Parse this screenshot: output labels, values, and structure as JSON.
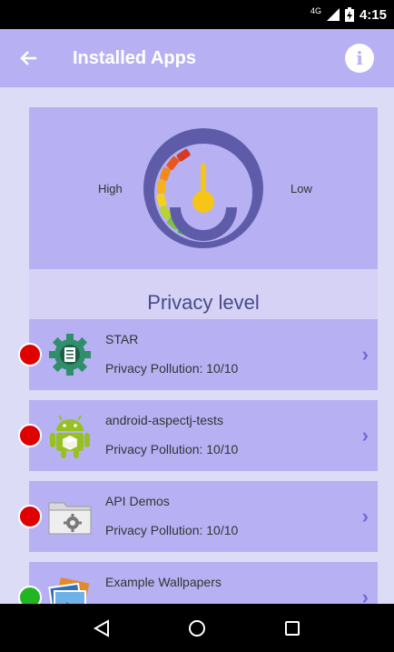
{
  "status_bar": {
    "network": "4G",
    "time": "4:15"
  },
  "app_bar": {
    "title": "Installed Apps",
    "back_icon": "arrow-left-icon",
    "info_icon": "info-icon",
    "info_glyph": "i"
  },
  "privacy": {
    "high_label": "High",
    "low_label": "Low",
    "title": "Privacy level",
    "gauge_level": 0.1
  },
  "apps": [
    {
      "name": "STAR",
      "pollution": "Privacy Pollution: 10/10",
      "status_color": "#e00000",
      "icon": "gear-document-icon"
    },
    {
      "name": "android-aspectj-tests",
      "pollution": "Privacy Pollution: 10/10",
      "status_color": "#e00000",
      "icon": "android-robot-icon"
    },
    {
      "name": "API Demos",
      "pollution": "Privacy Pollution: 10/10",
      "status_color": "#e00000",
      "icon": "folder-gear-icon"
    },
    {
      "name": "Example Wallpapers",
      "pollution": "",
      "status_color": "#22b522",
      "icon": "pictures-icon"
    }
  ],
  "colors": {
    "primary": "#b7b1f3",
    "background": "#dcdcf6",
    "title_bar": "#d5d2f6",
    "chevron": "#6f6bd4"
  }
}
